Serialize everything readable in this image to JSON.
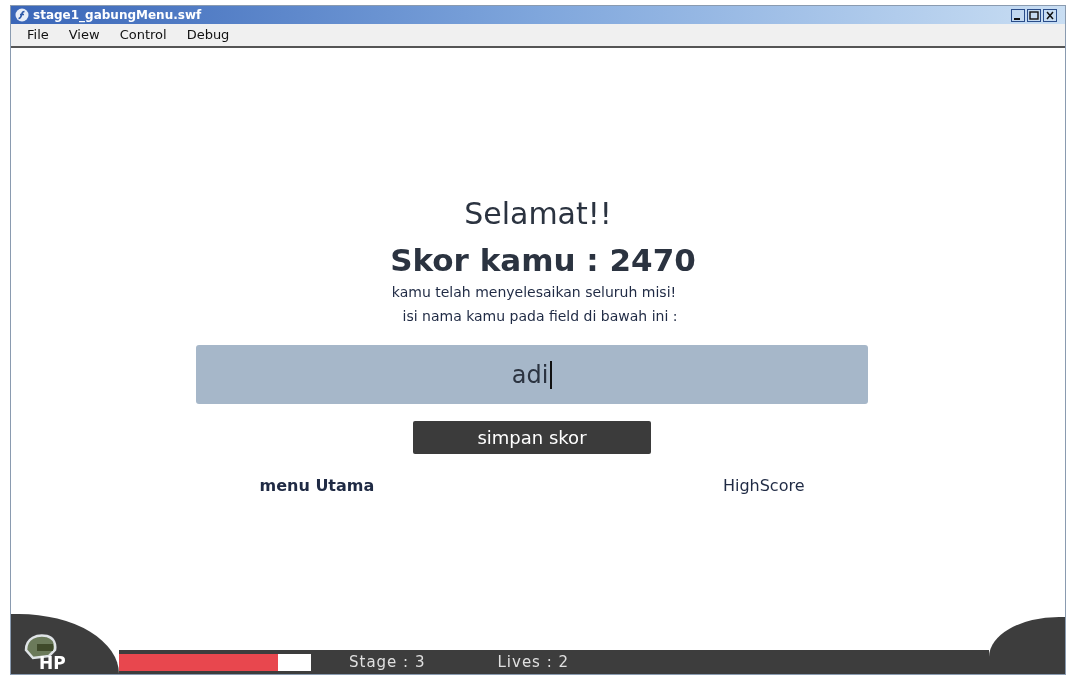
{
  "window": {
    "title": "stage1_gabungMenu.swf"
  },
  "menu": [
    "File",
    "View",
    "Control",
    "Debug"
  ],
  "heading": "Selamat!!",
  "score_line": "Skor kamu : 2470",
  "messages": [
    "kamu telah menyelesaikan seluruh misi!",
    "isi nama kamu pada field di bawah ini :"
  ],
  "name_field": {
    "value": "adi",
    "focused": true
  },
  "save_button": "simpan skor",
  "links": [
    "menu Utama",
    "HighScore"
  ],
  "hud": {
    "hp_label": "HP",
    "hp": {
      "level": 0.83
    },
    "stage": "Stage : 3",
    "lives": "Lives : 2"
  }
}
